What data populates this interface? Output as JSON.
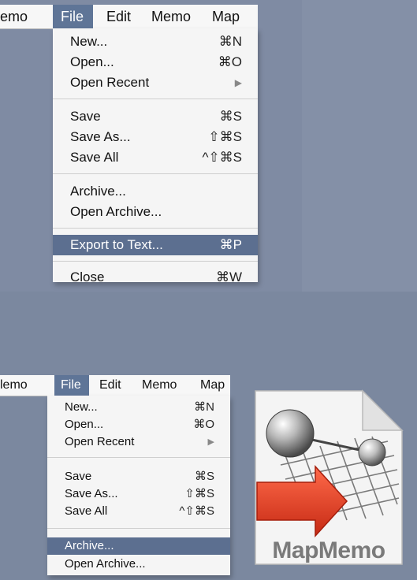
{
  "menubar_top": {
    "items": [
      "emo",
      "File",
      "Edit",
      "Memo",
      "Map"
    ],
    "active": "File"
  },
  "menu_top": {
    "items": [
      {
        "label": "New...",
        "shortcut": "⌘N"
      },
      {
        "label": "Open...",
        "shortcut": "⌘O"
      },
      {
        "label": "Open Recent",
        "shortcut": "▶"
      },
      {
        "label": "Save",
        "shortcut": "⌘S"
      },
      {
        "label": "Save As...",
        "shortcut": "⇧⌘S"
      },
      {
        "label": "Save All",
        "shortcut": "^⇧⌘S"
      },
      {
        "label": "Archive...",
        "shortcut": ""
      },
      {
        "label": "Open Archive...",
        "shortcut": ""
      },
      {
        "label": "Export to Text...",
        "shortcut": "⌘P",
        "highlighted": true
      },
      {
        "label": "Close",
        "shortcut": "⌘W"
      }
    ]
  },
  "menubar_bottom": {
    "items": [
      "lemo",
      "File",
      "Edit",
      "Memo",
      "Map"
    ],
    "active": "File"
  },
  "menu_bottom": {
    "items": [
      {
        "label": "New...",
        "shortcut": "⌘N"
      },
      {
        "label": "Open...",
        "shortcut": "⌘O"
      },
      {
        "label": "Open Recent",
        "shortcut": "▶"
      },
      {
        "label": "Save",
        "shortcut": "⌘S"
      },
      {
        "label": "Save As...",
        "shortcut": "⇧⌘S"
      },
      {
        "label": "Save All",
        "shortcut": "^⇧⌘S"
      },
      {
        "label": "Archive...",
        "shortcut": "",
        "highlighted": true
      },
      {
        "label": "Open Archive...",
        "shortcut": ""
      }
    ]
  },
  "app_icon": {
    "name": "MapMemo",
    "wordmark_part1": "Map",
    "wordmark_part2": "Memo",
    "colors": {
      "arrow": "#e03a22",
      "wordmark": "#7a7a7a",
      "page": "#f4f4f4"
    }
  },
  "colors": {
    "desktop": "#7d8aa2",
    "menu_bg": "#f5f5f5",
    "highlight": "#5c6f90"
  }
}
